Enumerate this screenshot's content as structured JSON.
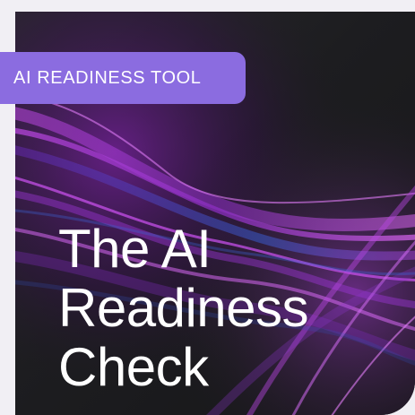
{
  "badge": {
    "label": "AI READINESS TOOL"
  },
  "headline": {
    "line1": "The AI",
    "line2": "Readiness",
    "line3": "Check"
  },
  "colors": {
    "page_background": "#f1eff4",
    "card_background": "#1c1c1f",
    "badge_background": "#8b6ce0",
    "wave_accent": "#b23bd6",
    "text": "#ffffff"
  }
}
